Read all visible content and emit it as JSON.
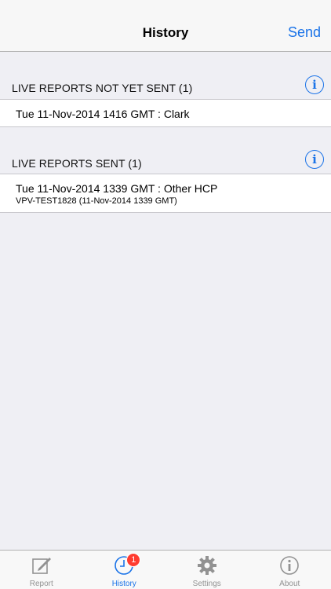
{
  "navbar": {
    "title": "History",
    "send_label": "Send"
  },
  "sections": [
    {
      "header": "LIVE REPORTS NOT YET SENT (1)",
      "info_icon": "info-icon",
      "items": [
        {
          "main": "Tue 11-Nov-2014 1416 GMT : Clark"
        }
      ]
    },
    {
      "header": "LIVE REPORTS SENT (1)",
      "info_icon": "info-icon",
      "items": [
        {
          "main": "Tue 11-Nov-2014 1339 GMT : Other HCP",
          "sub": "VPV-TEST1828 (11-Nov-2014 1339 GMT)"
        }
      ]
    }
  ],
  "tabbar": {
    "tabs": [
      {
        "label": "Report",
        "icon": "compose-icon",
        "active": false
      },
      {
        "label": "History",
        "icon": "clock-icon",
        "active": true,
        "badge": "1"
      },
      {
        "label": "Settings",
        "icon": "gear-icon",
        "active": false
      },
      {
        "label": "About",
        "icon": "info-icon",
        "active": false
      }
    ]
  },
  "colors": {
    "accent": "#1a73e8",
    "background": "#efeff4",
    "badge": "#ff3b30",
    "inactive_tab": "#929292"
  }
}
